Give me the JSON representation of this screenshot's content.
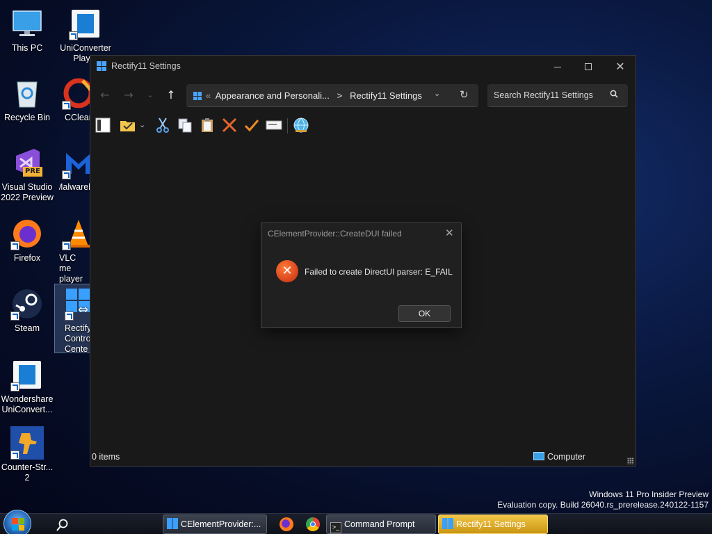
{
  "desktop": {
    "icons": [
      {
        "label": "This PC"
      },
      {
        "label": "UniConverter Player"
      },
      {
        "label": "Recycle Bin"
      },
      {
        "label": "CClean"
      },
      {
        "label": "Visual Studio 2022 Preview"
      },
      {
        "label": "Malwareb"
      },
      {
        "label": "Firefox"
      },
      {
        "label": "VLC me player"
      },
      {
        "label": "Steam"
      },
      {
        "label": "Rectify Contro Cente"
      },
      {
        "label": "Wondershare UniConvert..."
      },
      {
        "label": "Counter-Str... 2"
      }
    ],
    "vs_badge": "PRE"
  },
  "explorer": {
    "title": "Rectify11 Settings",
    "address": {
      "prefix": "«",
      "crumb1": "Appearance and Personali...",
      "separator": ">",
      "crumb2": "Rectify11 Settings"
    },
    "search_placeholder": "Search Rectify11 Settings",
    "status_items": "0 items",
    "status_location": "Computer"
  },
  "dialog": {
    "title": "CElementProvider::CreateDUI failed",
    "message": "Failed to create DirectUI parser: E_FAIL",
    "ok_label": "OK"
  },
  "watermark": {
    "line1": "Windows 11 Pro Insider Preview",
    "line2": "Evaluation copy. Build 26040.rs_prerelease.240122-1157"
  },
  "taskbar": {
    "buttons": [
      {
        "label": "CElementProvider:..."
      },
      {
        "label": "Command Prompt"
      },
      {
        "label": "Rectify11 Settings"
      }
    ]
  },
  "colors": {
    "accent": "#4aa3ff",
    "error": "#d6421a",
    "taskbar_active": "#e0b030"
  }
}
